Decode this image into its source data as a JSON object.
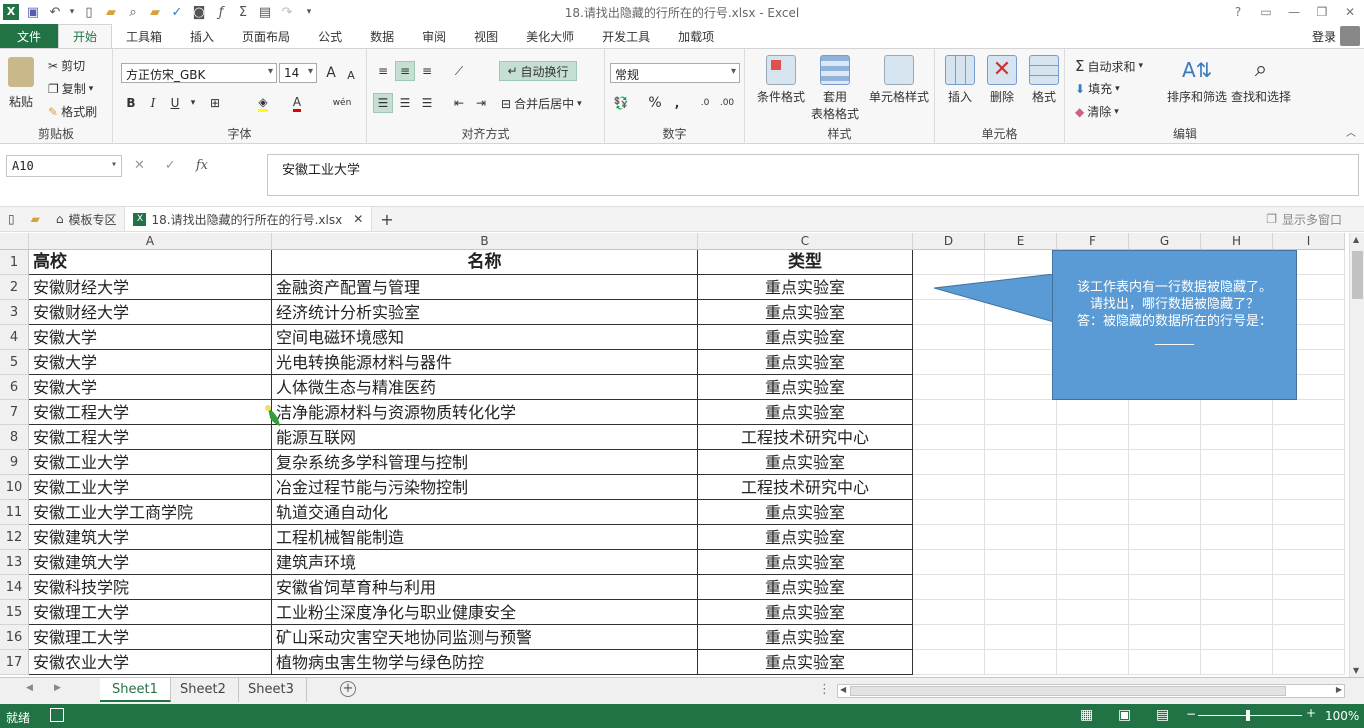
{
  "window": {
    "title": "18.请找出隐藏的行所在的行号.xlsx - Excel",
    "controls": [
      "?",
      "▭",
      "—",
      "❐",
      "✕"
    ]
  },
  "ribbon_tabs": [
    "文件",
    "开始",
    "工具箱",
    "插入",
    "页面布局",
    "公式",
    "数据",
    "审阅",
    "视图",
    "美化大师",
    "开发工具",
    "加载项"
  ],
  "active_tab": "开始",
  "login_label": "登录",
  "clipboard": {
    "paste": "粘贴",
    "cut": "剪切",
    "copy": "复制",
    "format_painter": "格式刷",
    "label": "剪贴板"
  },
  "font": {
    "name": "方正仿宋_GBK",
    "size": "14",
    "label": "字体",
    "bold": "B",
    "italic": "I",
    "underline": "U",
    "grow": "A",
    "shrink": "A",
    "wen": "wén"
  },
  "alignment": {
    "wrap": "自动换行",
    "merge": "合并后居中",
    "label": "对齐方式"
  },
  "number": {
    "format": "常规",
    "percent": "%",
    "comma": ",",
    "label": "数字"
  },
  "styles": {
    "conditional": "条件格式",
    "table_l1": "套用",
    "table_l2": "表格格式",
    "cell_styles": "单元格样式",
    "label": "样式"
  },
  "cells": {
    "insert": "插入",
    "delete": "删除",
    "format": "格式",
    "label": "单元格"
  },
  "editing": {
    "autosum": "自动求和",
    "fill": "填充",
    "clear": "清除",
    "sort": "排序和筛选",
    "find": "查找和选择",
    "label": "编辑"
  },
  "formula_bar": {
    "name_box": "A10",
    "cancel": "✕",
    "enter": "✓",
    "fx": "fx",
    "content": "安徽工业大学"
  },
  "file_tabs": {
    "template": "模板专区",
    "file": "18.请找出隐藏的行所在的行号.xlsx",
    "multi_window": "显示多窗口"
  },
  "columns": [
    "A",
    "B",
    "C",
    "D",
    "E",
    "F",
    "G",
    "H",
    "I"
  ],
  "rows": [
    {
      "n": "1",
      "a": "高校",
      "b": "名称",
      "c": "类型"
    },
    {
      "n": "2",
      "a": "安徽财经大学",
      "b": "金融资产配置与管理",
      "c": "重点实验室"
    },
    {
      "n": "3",
      "a": "安徽财经大学",
      "b": "经济统计分析实验室",
      "c": "重点实验室"
    },
    {
      "n": "4",
      "a": "安徽大学",
      "b": "空间电磁环境感知",
      "c": "重点实验室"
    },
    {
      "n": "5",
      "a": "安徽大学",
      "b": "光电转换能源材料与器件",
      "c": "重点实验室"
    },
    {
      "n": "6",
      "a": "安徽大学",
      "b": "人体微生态与精准医药",
      "c": "重点实验室"
    },
    {
      "n": "7",
      "a": "安徽工程大学",
      "b": "洁净能源材料与资源物质转化化学",
      "c": "重点实验室"
    },
    {
      "n": "8",
      "a": "安徽工程大学",
      "b": "能源互联网",
      "c": "工程技术研究中心"
    },
    {
      "n": "9",
      "a": "安徽工业大学",
      "b": "复杂系统多学科管理与控制",
      "c": "重点实验室"
    },
    {
      "n": "10",
      "a": "安徽工业大学",
      "b": "冶金过程节能与污染物控制",
      "c": "工程技术研究中心"
    },
    {
      "n": "11",
      "a": "安徽工业大学工商学院",
      "b": "轨道交通自动化",
      "c": "重点实验室"
    },
    {
      "n": "12",
      "a": "安徽建筑大学",
      "b": "工程机械智能制造",
      "c": "重点实验室"
    },
    {
      "n": "13",
      "a": "安徽建筑大学",
      "b": "建筑声环境",
      "c": "重点实验室"
    },
    {
      "n": "14",
      "a": "安徽科技学院",
      "b": "安徽省饲草育种与利用",
      "c": "重点实验室"
    },
    {
      "n": "15",
      "a": "安徽理工大学",
      "b": "工业粉尘深度净化与职业健康安全",
      "c": "重点实验室"
    },
    {
      "n": "16",
      "a": "安徽理工大学",
      "b": "矿山采动灾害空天地协同监测与预警",
      "c": "重点实验室"
    },
    {
      "n": "17",
      "a": "安徽农业大学",
      "b": "植物病虫害生物学与绿色防控",
      "c": "重点实验室"
    }
  ],
  "callout": {
    "line1": "该工作表内有一行数据被隐藏了。",
    "line2": "请找出，哪行数据被隐藏了？",
    "line3": "答：被隐藏的数据所在的行号是：",
    "line4": "______"
  },
  "sheets": [
    "Sheet1",
    "Sheet2",
    "Sheet3"
  ],
  "active_sheet": "Sheet1",
  "status": {
    "ready": "就绪",
    "zoom": "100%"
  },
  "colors": {
    "excel_green": "#217346",
    "callout": "#5b9bd5"
  }
}
